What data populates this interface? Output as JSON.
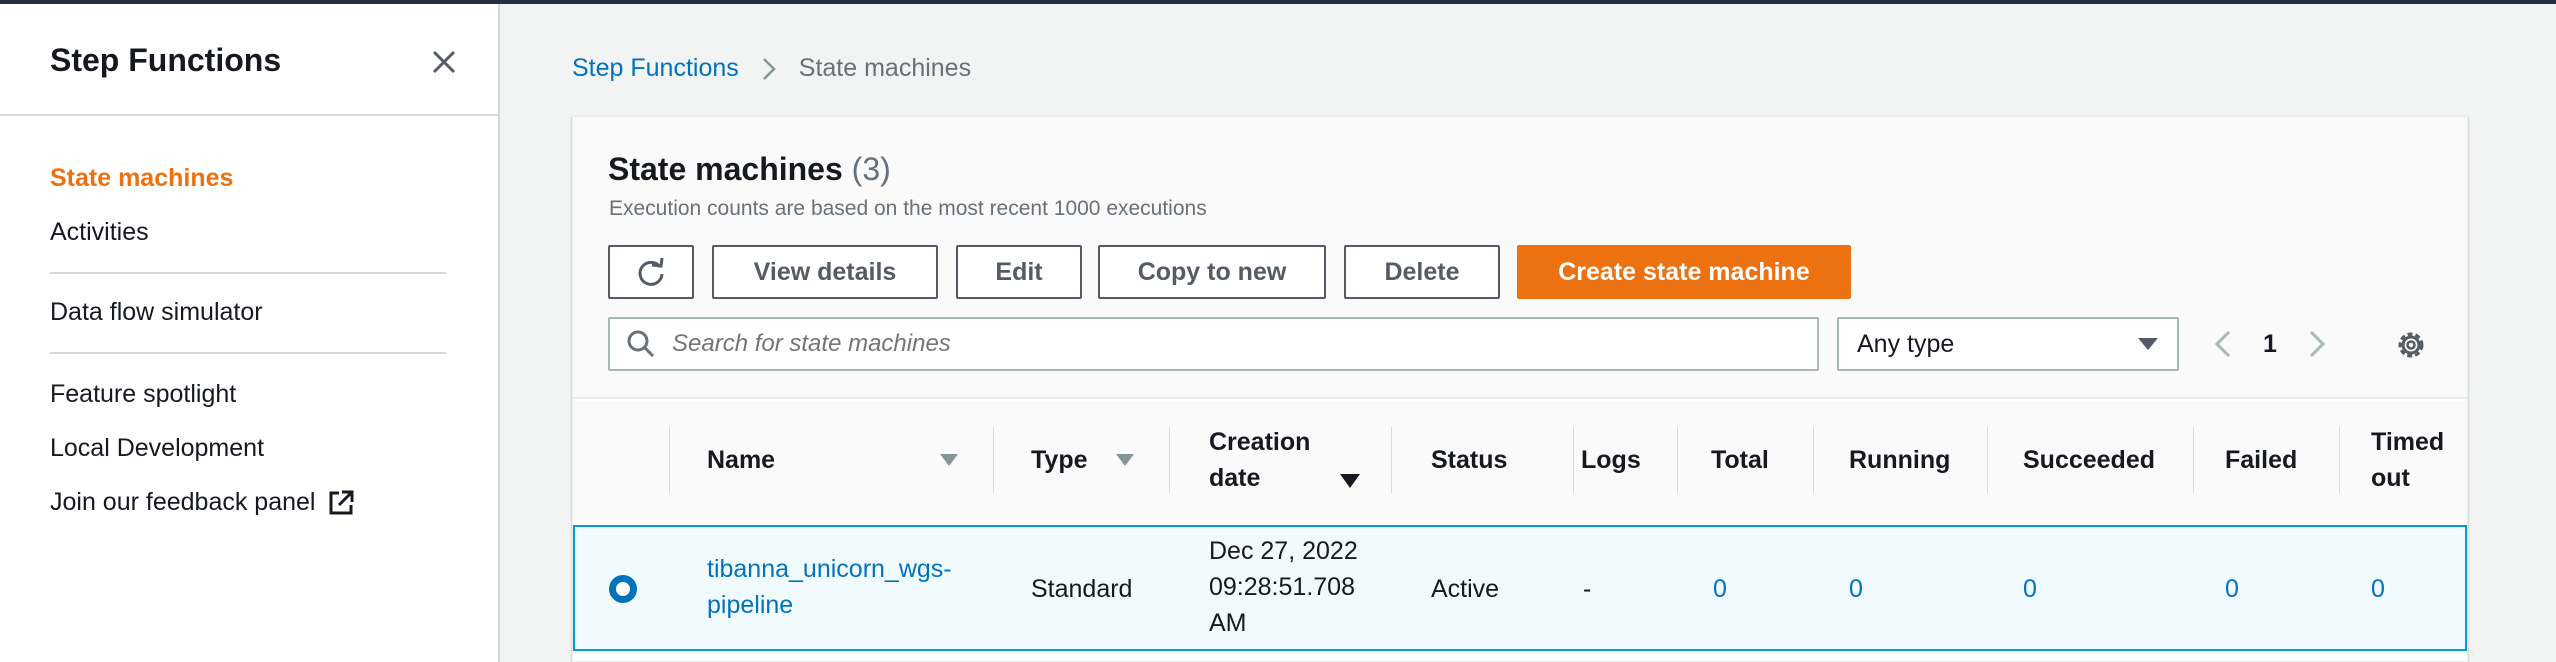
{
  "sidebar": {
    "title": "Step Functions",
    "items": [
      {
        "label": "State machines"
      },
      {
        "label": "Activities"
      },
      {
        "label": "Data flow simulator"
      },
      {
        "label": "Feature spotlight"
      },
      {
        "label": "Local Development"
      },
      {
        "label": "Join our feedback panel"
      }
    ]
  },
  "breadcrumb": {
    "root": "Step Functions",
    "current": "State machines"
  },
  "panel": {
    "title": "State machines",
    "count": "(3)",
    "subtitle": "Execution counts are based on the most recent 1000 executions"
  },
  "toolbar": {
    "view_details": "View details",
    "edit": "Edit",
    "copy_to_new": "Copy to new",
    "delete": "Delete",
    "create": "Create state machine"
  },
  "search": {
    "placeholder": "Search for state machines"
  },
  "type_filter": {
    "value": "Any type"
  },
  "pagination": {
    "page": "1"
  },
  "table": {
    "columns": [
      "Name",
      "Type",
      "Creation date",
      "Status",
      "Logs",
      "Total",
      "Running",
      "Succeeded",
      "Failed",
      "Timed out"
    ],
    "rows": [
      {
        "name": "tibanna_unicorn_wgs-pipeline",
        "type": "Standard",
        "creation_date": "Dec 27, 2022 09:28:51.708 AM",
        "status": "Active",
        "logs": "-",
        "total": "0",
        "running": "0",
        "succeeded": "0",
        "failed": "0",
        "timed_out": "0"
      }
    ]
  },
  "colors": {
    "accent": "#ec7211",
    "link": "#0073bb",
    "selected_row": "#f1faff"
  }
}
